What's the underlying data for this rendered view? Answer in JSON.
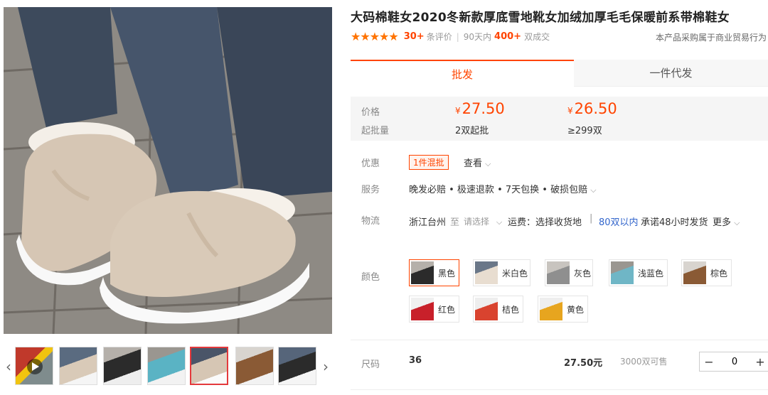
{
  "product": {
    "title": "大码棉鞋女2020冬新款厚底雪地靴女加绒加厚毛毛保暖前系带棉鞋女",
    "stars": "★★★★★",
    "review_count": "30+",
    "review_label": "条评价",
    "period_label": "90天内",
    "sold_count": "400+",
    "sold_label": "双成交",
    "notice": "本产品采购属于商业贸易行为"
  },
  "tabs": [
    {
      "label": "批发",
      "active": true
    },
    {
      "label": "一件代发",
      "active": false
    }
  ],
  "price": {
    "price_label": "价格",
    "moq_label": "起批量",
    "currency": "¥",
    "tiers": [
      {
        "price": "27.50",
        "qty": "2双起批"
      },
      {
        "price": "26.50",
        "qty": "≥299双"
      }
    ]
  },
  "promo": {
    "label": "优惠",
    "badge": "1件混批",
    "more": "查看"
  },
  "service": {
    "label": "服务",
    "text": "晚发必赔 • 极速退款 • 7天包换 • 破损包赔"
  },
  "logistics": {
    "label": "物流",
    "origin": "浙江台州",
    "to": "至",
    "select": "请选择",
    "fee": "运费：选择收货地",
    "within": "80双以内",
    "promise": "承诺48小时发货",
    "more": "更多"
  },
  "colors": {
    "label": "颜色",
    "items": [
      {
        "name": "黑色",
        "swatch": "#2b2b2b",
        "selected": true
      },
      {
        "name": "米白色",
        "swatch": "#e8ddd0",
        "selected": false
      },
      {
        "name": "灰色",
        "swatch": "#8f8f8f",
        "selected": false
      },
      {
        "name": "浅蓝色",
        "swatch": "#6fb6c6",
        "selected": false
      },
      {
        "name": "棕色",
        "swatch": "#8a5a35",
        "selected": false
      },
      {
        "name": "红色",
        "swatch": "#c8202a",
        "selected": false
      },
      {
        "name": "桔色",
        "swatch": "#d9432f",
        "selected": false
      },
      {
        "name": "黄色",
        "swatch": "#e7a51f",
        "selected": false
      }
    ]
  },
  "size": {
    "label": "尺码",
    "value": "36",
    "price": "27.50元",
    "stock": "3000双可售",
    "qty": "0",
    "minus": "−",
    "plus": "+"
  },
  "gallery": {
    "prev_arrow": "‹",
    "next_arrow": "›",
    "thumb_count": 7,
    "active_thumb_index": 4
  }
}
